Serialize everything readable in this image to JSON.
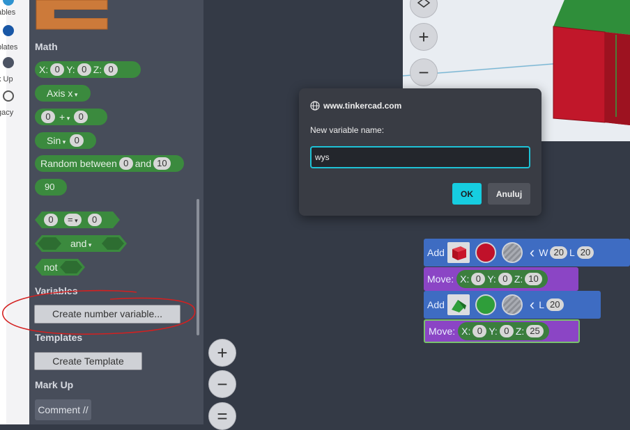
{
  "categories": [
    {
      "label": "ables",
      "color": "#2f93d0"
    },
    {
      "label": "plates",
      "color": "#1957a6"
    },
    {
      "label": "k Up",
      "color": "#4c5363"
    },
    {
      "label": "gacy",
      "color": "#f5f5f5"
    }
  ],
  "palette": {
    "math_title": "Math",
    "xyz": {
      "x_label": "X:",
      "x_value": "0",
      "y_label": "Y:",
      "y_value": "0",
      "z_label": "Z:",
      "z_value": "0"
    },
    "axis_dropdown": "Axis x",
    "arith": {
      "left": "0",
      "op": "+",
      "right": "0"
    },
    "sin": {
      "fn": "Sin",
      "value": "0"
    },
    "random": {
      "label": "Random between",
      "from": "0",
      "and": "and",
      "to": "10"
    },
    "number": "90",
    "compare": {
      "left": "0",
      "op": "=",
      "right": "0"
    },
    "logic_and": "and",
    "logic_not": "not",
    "variables_title": "Variables",
    "create_variable": "Create number variable...",
    "templates_title": "Templates",
    "create_template": "Create Template",
    "markup_title": "Mark Up",
    "comment": "Comment //"
  },
  "zoom": {
    "plus": "+",
    "minus": "−",
    "reset": "="
  },
  "blocks": {
    "add1": {
      "label": "Add",
      "w_label": "W",
      "w_value": "20",
      "l_label": "L",
      "l_value": "20",
      "color_hex": "#c0112a"
    },
    "move1": {
      "label": "Move:",
      "x_label": "X:",
      "x_value": "0",
      "y_label": "Y:",
      "y_value": "0",
      "z_label": "Z:",
      "z_value": "10"
    },
    "add2": {
      "label": "Add",
      "l_label": "L",
      "l_value": "20",
      "color_hex": "#2f9e3a"
    },
    "move2": {
      "label": "Move:",
      "x_label": "X:",
      "x_value": "0",
      "y_label": "Y:",
      "y_value": "0",
      "z_label": "Z:",
      "z_value": "25"
    }
  },
  "dialog": {
    "host": "www.tinkercad.com",
    "prompt": "New variable name:",
    "value": "wys",
    "ok": "OK",
    "cancel": "Anuluj",
    "accent": "#16cde0"
  }
}
